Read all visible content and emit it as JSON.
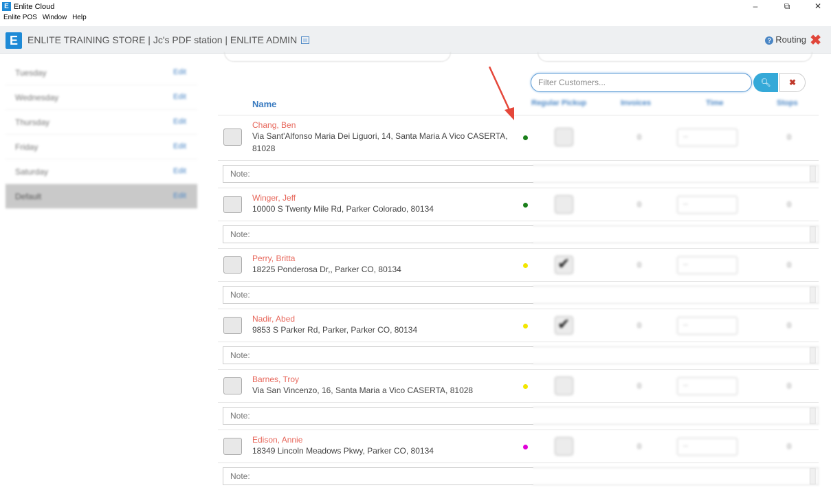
{
  "window": {
    "title": "Enlite Cloud",
    "app_icon": "E",
    "minimize": "–",
    "restore": "⧉",
    "close": "✕"
  },
  "menu": [
    "Enlite POS",
    "Window",
    "Help"
  ],
  "header": {
    "logo": "E",
    "store_text": "ENLITE TRAINING STORE | Jc's PDF station | ENLITE ADMIN",
    "routing_label": "Routing",
    "help_icon_glyph": "?",
    "close_glyph": "✖"
  },
  "sidebar": {
    "items": [
      {
        "day": "Tuesday",
        "edit": "Edit"
      },
      {
        "day": "Wednesday",
        "edit": "Edit"
      },
      {
        "day": "Thursday",
        "edit": "Edit"
      },
      {
        "day": "Friday",
        "edit": "Edit"
      },
      {
        "day": "Saturday",
        "edit": "Edit"
      },
      {
        "day": "Default",
        "edit": "Edit"
      }
    ]
  },
  "filter": {
    "placeholder": "Filter Customers...",
    "search_glyph": "🔍",
    "clear_glyph": "✖"
  },
  "columns": {
    "name": "Name",
    "regular_pickup": "Regular Pickup",
    "invoices": "Invoices",
    "time": "Time",
    "stops": "Stops"
  },
  "note_placeholder": "Note:",
  "customers": [
    {
      "name": "Chang, Ben",
      "address": "Via Sant'Alfonso Maria Dei Liguori, 14, Santa Maria A Vico CASERTA, 81028",
      "dot_color": "#1a7f1a",
      "pickup": false,
      "invoices": "0",
      "time": "--",
      "stops": "0"
    },
    {
      "name": "Winger, Jeff",
      "address": "10000 S Twenty Mile Rd, Parker Colorado, 80134",
      "dot_color": "#1a7f1a",
      "pickup": false,
      "invoices": "0",
      "time": "--",
      "stops": "0"
    },
    {
      "name": "Perry, Britta",
      "address": "18225 Ponderosa Dr,, Parker CO, 80134",
      "dot_color": "#f2e600",
      "pickup": true,
      "invoices": "0",
      "time": "--",
      "stops": "0"
    },
    {
      "name": "Nadir, Abed",
      "address": "9853 S Parker Rd, Parker, Parker CO, 80134",
      "dot_color": "#f2e600",
      "pickup": true,
      "invoices": "0",
      "time": "--",
      "stops": "0"
    },
    {
      "name": "Barnes, Troy",
      "address": "Via San Vincenzo, 16, Santa Maria a Vico CASERTA, 81028",
      "dot_color": "#f2e600",
      "pickup": false,
      "invoices": "0",
      "time": "--",
      "stops": "0"
    },
    {
      "name": "Edison, Annie",
      "address": "18349 Lincoln Meadows Pkwy, Parker CO, 80134",
      "dot_color": "#e000d8",
      "pickup": false,
      "invoices": "0",
      "time": "--",
      "stops": "0"
    }
  ]
}
